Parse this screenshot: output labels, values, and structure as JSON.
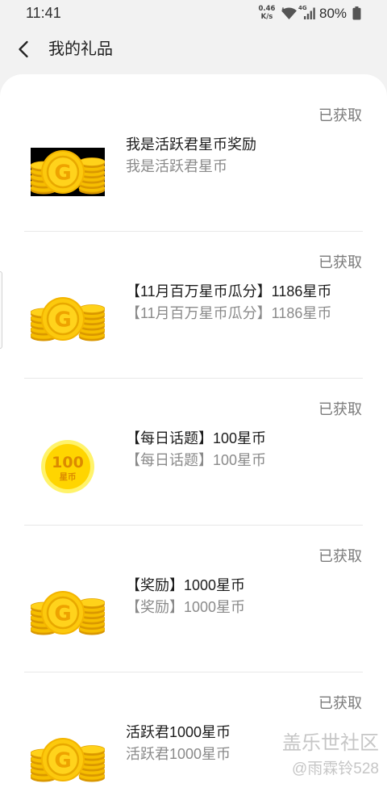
{
  "status_bar": {
    "time": "11:41",
    "net_speed": "0.46",
    "net_speed_unit": "K/s",
    "network_type": "4G",
    "battery": "80%",
    "icons": [
      "wifi-icon",
      "signal-icon",
      "battery-icon"
    ]
  },
  "header": {
    "back_icon": "chevron-left-icon",
    "title": "我的礼品"
  },
  "gifts": [
    {
      "status": "已获取",
      "title": "我是活跃君星币奖励",
      "subtitle": "我是活跃君星币",
      "icon": "gold-coins-icon"
    },
    {
      "status": "已获取",
      "title": "【11月百万星币瓜分】1186星币",
      "subtitle": "【11月百万星币瓜分】1186星币",
      "icon": "gold-coins-icon"
    },
    {
      "status": "已获取",
      "title": "【每日话题】100星币",
      "subtitle": "【每日话题】100星币",
      "icon": "star-coin-100-icon",
      "icon_value": "100",
      "icon_unit": "星币"
    },
    {
      "status": "已获取",
      "title": "【奖励】1000星币",
      "subtitle": "【奖励】1000星币",
      "icon": "gold-coins-icon"
    },
    {
      "status": "已获取",
      "title": "活跃君1000星币",
      "subtitle": "活跃君1000星币",
      "icon": "gold-coins-icon"
    }
  ],
  "coin_icon_letter": "G",
  "watermark": {
    "brand": "盖乐世社区",
    "author": "@雨霖铃528"
  },
  "colors": {
    "page_bg": "#f2f2f2",
    "card_bg": "#ffffff",
    "coin_gold": "#f7c10a",
    "status_text": "#7b7b7b",
    "subtitle_text": "#8a8a8a"
  }
}
